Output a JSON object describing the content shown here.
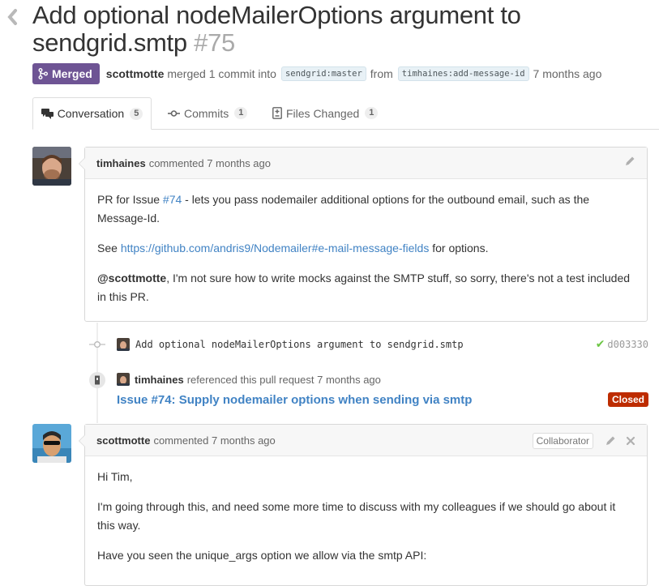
{
  "pr": {
    "title": "Add optional nodeMailerOptions argument to sendgrid.smtp",
    "number": "#75",
    "state": "Merged",
    "author": "scottmotte",
    "action": "merged 1 commit into",
    "base_branch": "sendgrid:master",
    "from_label": "from",
    "head_branch": "timhaines:add-message-id",
    "time_ago": "7 months ago"
  },
  "tabs": [
    {
      "label": "Conversation",
      "count": "5",
      "icon": "comment-discussion-icon",
      "active": true
    },
    {
      "label": "Commits",
      "count": "1",
      "icon": "git-commit-icon",
      "active": false
    },
    {
      "label": "Files Changed",
      "count": "1",
      "icon": "diff-icon",
      "active": false
    }
  ],
  "comment1": {
    "author": "timhaines",
    "meta": "commented 7 months ago",
    "p1_pre": "PR for Issue ",
    "p1_link": "#74",
    "p1_post": " - lets you pass nodemailer additional options for the outbound email, such as the Message-Id.",
    "p2_pre": "See ",
    "p2_link": "https://github.com/andris9/Nodemailer#e-mail-message-fields",
    "p2_post": " for options.",
    "p3_mention": "@scottmotte",
    "p3_post": ", I'm not sure how to write mocks against the SMTP stuff, so sorry, there's not a test included in this PR."
  },
  "commit": {
    "message": "Add optional nodeMailerOptions argument to sendgrid.smtp",
    "sha": "d003330"
  },
  "reference": {
    "author": "timhaines",
    "text": "referenced this pull request 7 months ago",
    "issue_title": "Issue #74: Supply nodemailer options when sending via smtp",
    "status": "Closed"
  },
  "comment2": {
    "author": "scottmotte",
    "meta": "commented 7 months ago",
    "role": "Collaborator",
    "p1": "Hi Tim,",
    "p2": "I'm going through this, and need some more time to discuss with my colleagues if we should go about it this way.",
    "p3": "Have you seen the unique_args option we allow via the smtp API:"
  },
  "colors": {
    "merged": "#6e5494",
    "closed": "#bd2c00",
    "link": "#4183c4",
    "check": "#6cc644"
  }
}
